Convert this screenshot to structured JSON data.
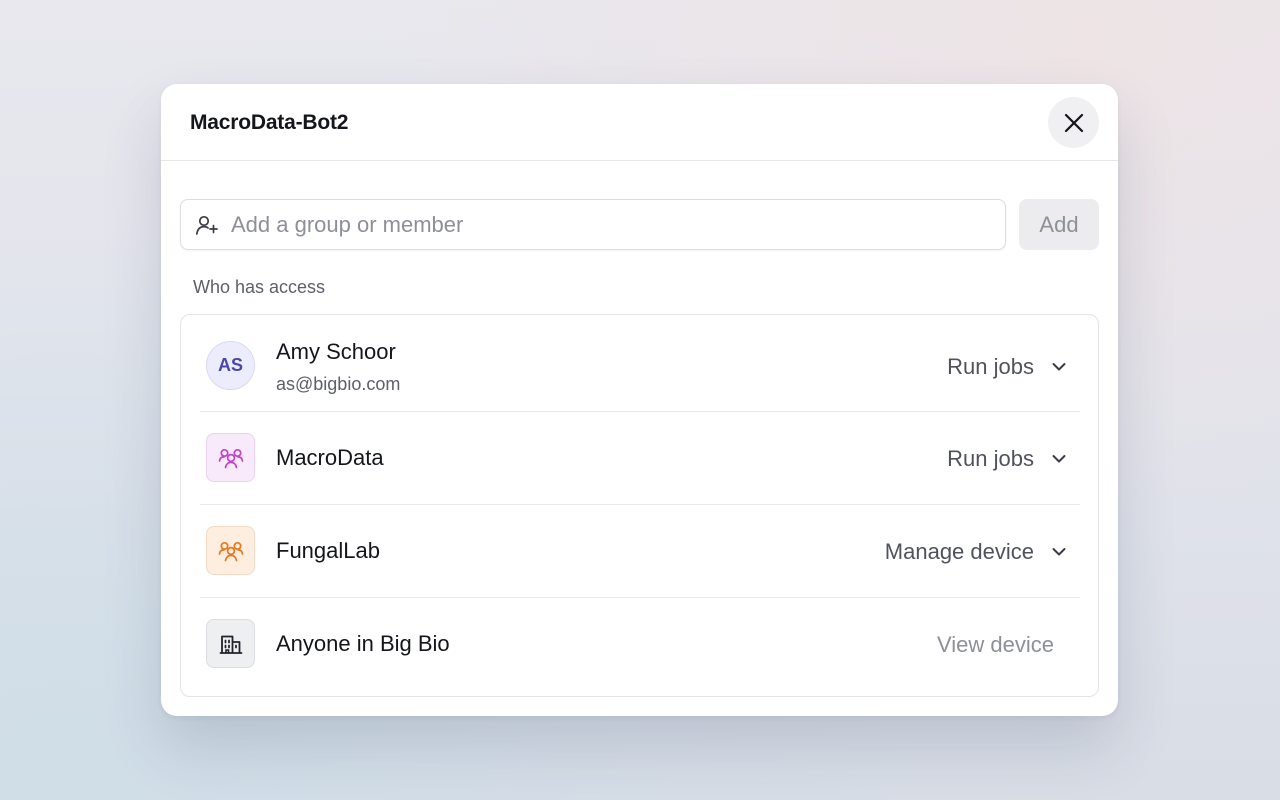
{
  "dialog": {
    "title": "MacroData-Bot2",
    "close_icon": "close-icon"
  },
  "search": {
    "icon": "add-person-icon",
    "placeholder": "Add a group or member",
    "value": "",
    "add_label": "Add"
  },
  "access": {
    "section_label": "Who has access",
    "entries": [
      {
        "type": "user",
        "initials": "AS",
        "name": "Amy Schoor",
        "email": "as@bigbio.com",
        "role": "Run jobs",
        "role_editable": true
      },
      {
        "type": "group",
        "icon": "group-icon",
        "icon_color": "#c042c8",
        "name": "MacroData",
        "role": "Run jobs",
        "role_editable": true
      },
      {
        "type": "group",
        "icon": "group-icon",
        "icon_color": "#e8761e",
        "name": "FungalLab",
        "role": "Manage device",
        "role_editable": true
      },
      {
        "type": "organization",
        "icon": "building-icon",
        "icon_color": "#1f232b",
        "name": "Anyone in Big Bio",
        "role": "View device",
        "role_editable": false
      }
    ]
  },
  "colors": {
    "text_primary": "#14161c",
    "text_secondary": "#5d606a",
    "text_muted": "#8e9099",
    "initials_accent": "#4a47a8"
  }
}
